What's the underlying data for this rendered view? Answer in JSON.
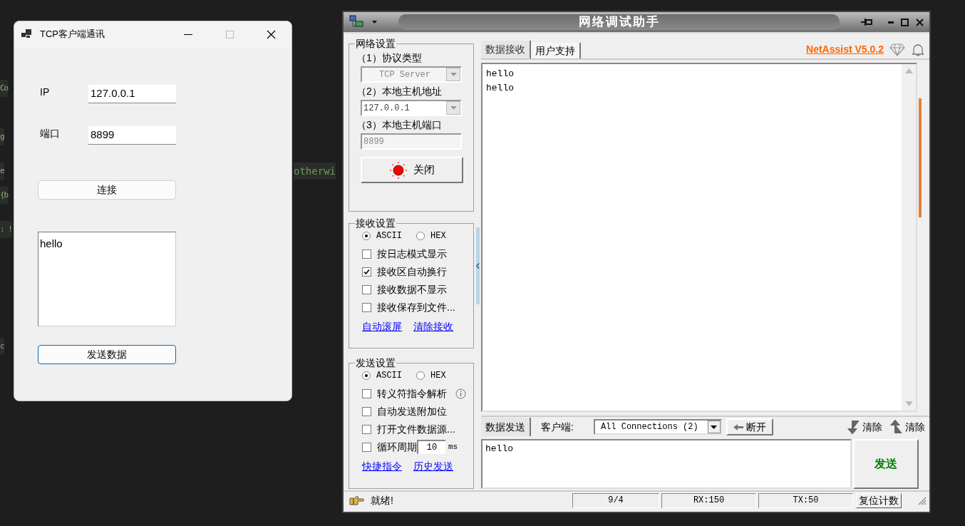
{
  "background_code": [
    {
      "left": "Co"
    },
    {
      "left": "g"
    },
    {
      "left": "e",
      "right": "otherwi"
    },
    {
      "left": "{b"
    },
    {
      "left": ": !"
    },
    {
      "left": "c"
    }
  ],
  "client_window": {
    "title": "TCP客户端通讯",
    "fields": [
      {
        "label": "IP",
        "value": "127.0.0.1"
      },
      {
        "label": "端口",
        "value": "8899"
      }
    ],
    "connect_button": "连接",
    "message_box": "hello",
    "send_button": {
      "label": "发送数据",
      "focused": true
    }
  },
  "net_assist": {
    "title": "网络调试助手",
    "network_settings": {
      "title": "网络设置",
      "fields": [
        {
          "label": "（1）协议类型",
          "value": "TCP Server",
          "kind": "select",
          "disabled": true
        },
        {
          "label": "（2）本地主机地址",
          "value": "127.0.0.1",
          "kind": "select",
          "disabled": false
        },
        {
          "label": "（3）本地主机端口",
          "value": "8899",
          "kind": "input",
          "disabled": true
        }
      ],
      "toggle_button": {
        "label": "关闭",
        "connected": true
      }
    },
    "receive_settings": {
      "title": "接收设置",
      "formats": [
        {
          "label": "ASCII",
          "selected": true
        },
        {
          "label": "HEX",
          "selected": false
        }
      ],
      "options": [
        {
          "label": "按日志模式显示",
          "checked": false
        },
        {
          "label": "接收区自动换行",
          "checked": true
        },
        {
          "label": "接收数据不显示",
          "checked": false
        },
        {
          "label": "接收保存到文件...",
          "checked": false
        }
      ],
      "links": [
        "自动滚屏",
        "清除接收"
      ]
    },
    "send_settings": {
      "title": "发送设置",
      "formats": [
        {
          "label": "ASCII",
          "selected": true
        },
        {
          "label": "HEX",
          "selected": false
        }
      ],
      "options": [
        {
          "label": "转义符指令解析",
          "checked": false,
          "kind": "info"
        },
        {
          "label": "自动发送附加位",
          "checked": false,
          "kind": "plain"
        },
        {
          "label": "打开文件数据源...",
          "checked": false,
          "kind": "plain"
        },
        {
          "label": "循环周期",
          "checked": false,
          "kind": "period",
          "value": "10",
          "unit": "ms"
        }
      ],
      "links": [
        "快捷指令",
        "历史发送"
      ]
    },
    "receive_tabs": [
      {
        "label": "数据接收",
        "selected": true
      },
      {
        "label": "用户支持",
        "selected": false
      }
    ],
    "version_link": "NetAssist V5.0.2",
    "received_lines": [
      "hello",
      "hello"
    ],
    "send_bar": {
      "tab": "数据发送",
      "client_label": "客户端:",
      "client_select": "All Connections (2)",
      "disconnect_button": "断开",
      "clear_buttons": [
        {
          "label": "清除",
          "kind": "down"
        },
        {
          "label": "清除",
          "kind": "up"
        }
      ]
    },
    "send_text": "hello",
    "send_button": "发送",
    "status": {
      "message": "就绪!",
      "cells": [
        "9/4",
        "RX:150",
        "TX:50"
      ],
      "reset_button": "复位计数"
    }
  }
}
